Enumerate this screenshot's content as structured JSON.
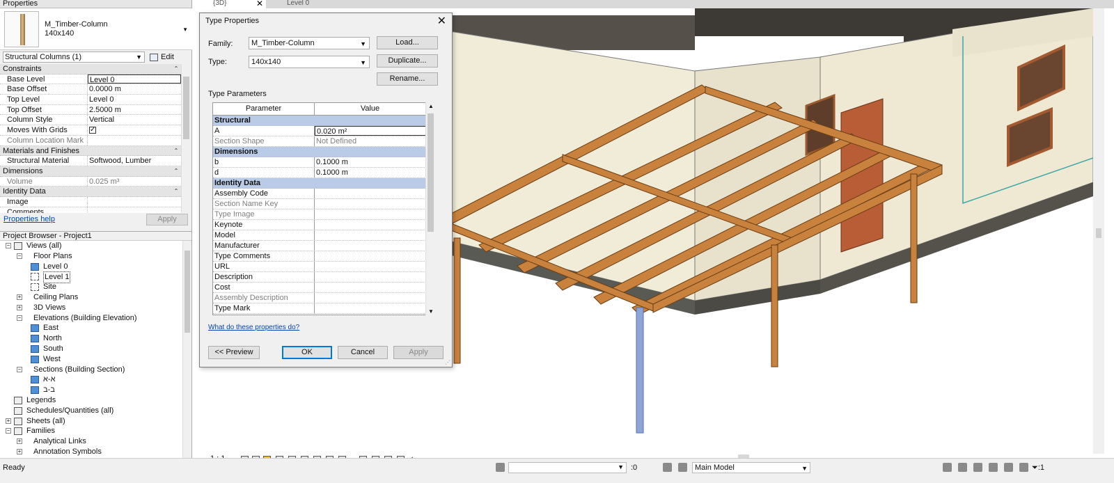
{
  "properties_panel": {
    "title": "Properties",
    "type_name_line1": "M_Timber-Column",
    "type_name_line2": "140x140",
    "category_selector": "Structural Columns (1)",
    "edit_type_label": "Edit Type",
    "rows": [
      {
        "kind": "group",
        "name": "Constraints"
      },
      {
        "kind": "prop",
        "name": "Base Level",
        "value": "Level 0",
        "selected": true
      },
      {
        "kind": "prop",
        "name": "Base Offset",
        "value": "0.0000 m"
      },
      {
        "kind": "prop",
        "name": "Top Level",
        "value": "Level 0"
      },
      {
        "kind": "prop",
        "name": "Top Offset",
        "value": "2.5000 m"
      },
      {
        "kind": "prop",
        "name": "Column Style",
        "value": "Vertical"
      },
      {
        "kind": "prop",
        "name": "Moves With Grids",
        "value": "",
        "checkbox": true
      },
      {
        "kind": "prop",
        "name": "Column Location Mark",
        "value": "",
        "dim": true
      },
      {
        "kind": "group",
        "name": "Materials and Finishes"
      },
      {
        "kind": "prop",
        "name": "Structural Material",
        "value": "Softwood, Lumber"
      },
      {
        "kind": "group",
        "name": "Dimensions"
      },
      {
        "kind": "prop",
        "name": "Volume",
        "value": "0.025 m³",
        "dim": true
      },
      {
        "kind": "group",
        "name": "Identity Data"
      },
      {
        "kind": "prop",
        "name": "Image",
        "value": ""
      },
      {
        "kind": "prop",
        "name": "Comments",
        "value": ""
      }
    ],
    "help_link": "Properties help",
    "apply_label": "Apply"
  },
  "project_browser": {
    "title": "Project Browser - Project1",
    "nodes": [
      {
        "indent": 0,
        "exp": "-",
        "icon": "group",
        "label": "Views (all)"
      },
      {
        "indent": 1,
        "exp": "-",
        "icon": "none",
        "label": "Floor Plans"
      },
      {
        "indent": 2,
        "exp": "",
        "icon": "view",
        "label": "Level 0"
      },
      {
        "indent": 2,
        "exp": "",
        "icon": "view-empty",
        "label": "Level 1",
        "highlight": true
      },
      {
        "indent": 2,
        "exp": "",
        "icon": "view-empty",
        "label": "Site"
      },
      {
        "indent": 1,
        "exp": "+",
        "icon": "none",
        "label": "Ceiling Plans"
      },
      {
        "indent": 1,
        "exp": "+",
        "icon": "none",
        "label": "3D Views"
      },
      {
        "indent": 1,
        "exp": "-",
        "icon": "none",
        "label": "Elevations (Building Elevation)"
      },
      {
        "indent": 2,
        "exp": "",
        "icon": "view",
        "label": "East"
      },
      {
        "indent": 2,
        "exp": "",
        "icon": "view",
        "label": "North"
      },
      {
        "indent": 2,
        "exp": "",
        "icon": "view",
        "label": "South"
      },
      {
        "indent": 2,
        "exp": "",
        "icon": "view",
        "label": "West"
      },
      {
        "indent": 1,
        "exp": "-",
        "icon": "none",
        "label": "Sections (Building Section)"
      },
      {
        "indent": 2,
        "exp": "",
        "icon": "view",
        "label": "א-א"
      },
      {
        "indent": 2,
        "exp": "",
        "icon": "view",
        "label": "ב-ב"
      },
      {
        "indent": 0,
        "exp": "",
        "icon": "group",
        "label": "Legends"
      },
      {
        "indent": 0,
        "exp": "",
        "icon": "group",
        "label": "Schedules/Quantities (all)"
      },
      {
        "indent": 0,
        "exp": "+",
        "icon": "group",
        "label": "Sheets (all)"
      },
      {
        "indent": 0,
        "exp": "-",
        "icon": "group",
        "label": "Families"
      },
      {
        "indent": 1,
        "exp": "+",
        "icon": "none",
        "label": "Analytical Links"
      },
      {
        "indent": 1,
        "exp": "+",
        "icon": "none",
        "label": "Annotation Symbols"
      }
    ]
  },
  "tabs": [
    {
      "label": "{3D}",
      "active": true
    },
    {
      "label": "Level 0",
      "active": false
    }
  ],
  "dialog": {
    "title": "Type Properties",
    "family_label": "Family:",
    "family_value": "M_Timber-Column",
    "type_label": "Type:",
    "type_value": "140x140",
    "load_button": "Load...",
    "duplicate_button": "Duplicate...",
    "rename_button": "Rename...",
    "type_parameters_label": "Type Parameters",
    "col_parameter": "Parameter",
    "col_value": "Value",
    "col_equals": "=",
    "rows": [
      {
        "kind": "group",
        "name": "Structural"
      },
      {
        "kind": "param",
        "name": "A",
        "value": "0.020 m²",
        "selected": true
      },
      {
        "kind": "param",
        "name": "Section Shape",
        "value": "Not Defined",
        "dim": true
      },
      {
        "kind": "group",
        "name": "Dimensions"
      },
      {
        "kind": "param",
        "name": "b",
        "value": "0.1000 m"
      },
      {
        "kind": "param",
        "name": "d",
        "value": "0.1000 m"
      },
      {
        "kind": "group",
        "name": "Identity Data"
      },
      {
        "kind": "param",
        "name": "Assembly Code",
        "value": ""
      },
      {
        "kind": "param",
        "name": "Section Name Key",
        "value": "",
        "dim": true
      },
      {
        "kind": "param",
        "name": "Type Image",
        "value": "",
        "dim": true
      },
      {
        "kind": "param",
        "name": "Keynote",
        "value": ""
      },
      {
        "kind": "param",
        "name": "Model",
        "value": ""
      },
      {
        "kind": "param",
        "name": "Manufacturer",
        "value": ""
      },
      {
        "kind": "param",
        "name": "Type Comments",
        "value": ""
      },
      {
        "kind": "param",
        "name": "URL",
        "value": ""
      },
      {
        "kind": "param",
        "name": "Description",
        "value": ""
      },
      {
        "kind": "param",
        "name": "Cost",
        "value": ""
      },
      {
        "kind": "param",
        "name": "Assembly Description",
        "value": "",
        "dim": true
      },
      {
        "kind": "param",
        "name": "Type Mark",
        "value": ""
      }
    ],
    "help_link": "What do these properties do?",
    "preview_button": "<< Preview",
    "ok_button": "OK",
    "cancel_button": "Cancel",
    "apply_button": "Apply"
  },
  "view_controls": {
    "scale": "1 : 1"
  },
  "status_bar": {
    "ready": "Ready",
    "selection_count": ":0",
    "model_selector": "Main Model",
    "filter_count": ":1"
  },
  "colors": {
    "timber": "#c8823e",
    "wall": "#ece6d0",
    "group_header": "#b9cbe6",
    "selected_column": "#8ea6d6"
  }
}
